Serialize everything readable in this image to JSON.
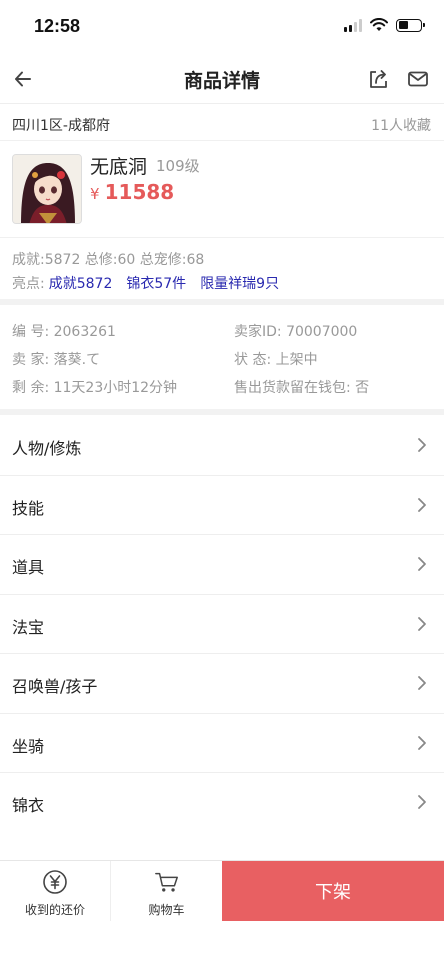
{
  "status_bar": {
    "time": "12:58"
  },
  "nav": {
    "title": "商品详情",
    "back_icon": "arrow-left-icon",
    "share_icon": "share-icon",
    "mail_icon": "mail-icon"
  },
  "server": {
    "name": "四川1区-成都府",
    "favorites": "11人收藏"
  },
  "character": {
    "name": "无底洞",
    "level": "109级",
    "currency": "¥",
    "price": "11588"
  },
  "stats": {
    "line": "成就:5872 总修:60 总宠修:68",
    "highlights_label": "亮点:",
    "highlights": [
      "成就5872",
      "锦衣57件",
      "限量祥瑞9只"
    ]
  },
  "info": {
    "id": "编   号: 2063261",
    "seller_id": "卖家ID: 70007000",
    "seller": "卖   家: 落葵.て",
    "status": "状   态: 上架中",
    "remaining": "剩   余: 11天23小时12分钟",
    "wallet": "售出货款留在钱包: 否"
  },
  "menu": [
    {
      "label": "人物/修炼"
    },
    {
      "label": "技能"
    },
    {
      "label": "道具"
    },
    {
      "label": "法宝"
    },
    {
      "label": "召唤兽/孩子"
    },
    {
      "label": "坐骑"
    },
    {
      "label": "锦衣"
    }
  ],
  "bottom_bar": {
    "offers_label": "收到的还价",
    "cart_label": "购物车",
    "delist_label": "下架"
  },
  "colors": {
    "price": "#e55a5a",
    "highlight": "#2a2ab0",
    "delist": "#e86062"
  }
}
